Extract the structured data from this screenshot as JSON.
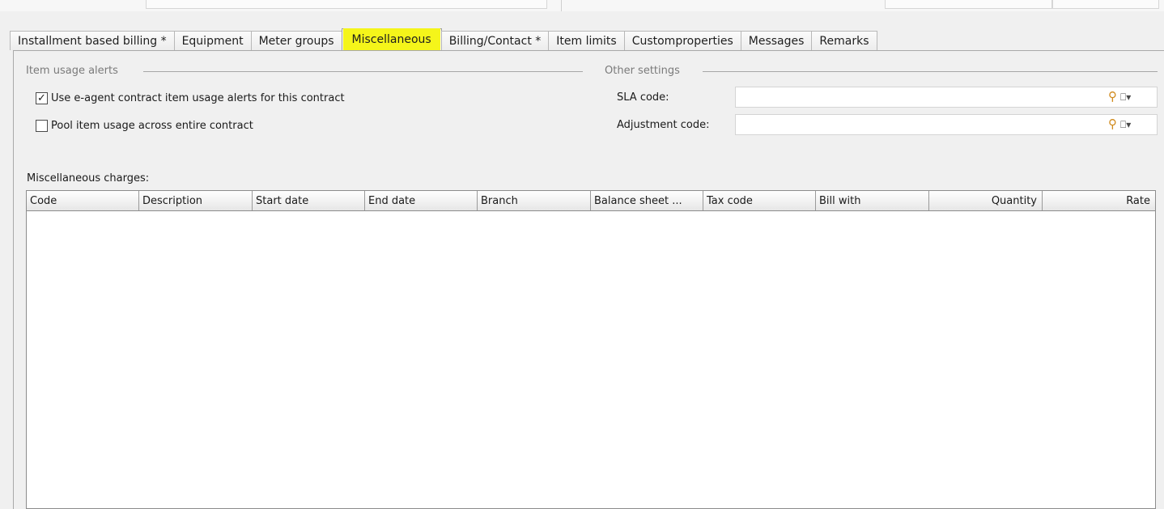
{
  "tabs": [
    {
      "label": "Installment based billing *"
    },
    {
      "label": "Equipment"
    },
    {
      "label": "Meter groups"
    },
    {
      "label": "Miscellaneous"
    },
    {
      "label": "Billing/Contact *"
    },
    {
      "label": "Item limits"
    },
    {
      "label": "Customproperties"
    },
    {
      "label": "Messages"
    },
    {
      "label": "Remarks"
    }
  ],
  "item_usage_alerts": {
    "title": "Item usage alerts",
    "use_alerts": {
      "label": "Use e-agent contract item usage alerts for this contract",
      "checked": true,
      "mark": "✓"
    },
    "pool_usage": {
      "label": "Pool item usage across entire contract",
      "checked": false,
      "mark": ""
    }
  },
  "other_settings": {
    "title": "Other settings",
    "sla": {
      "label": "SLA code:",
      "value": ""
    },
    "adjustment": {
      "label": "Adjustment code:",
      "value": ""
    }
  },
  "misc_charges": {
    "title": "Miscellaneous charges:",
    "columns": [
      "Code",
      "Description",
      "Start date",
      "End date",
      "Branch",
      "Balance sheet ...",
      "Tax code",
      "Bill with",
      "Quantity",
      "Rate"
    ],
    "rows": []
  },
  "colors": {
    "highlight": "#f5f51a",
    "panel_bg": "#f0f0f0",
    "lookup_icon": "#d08a1c"
  },
  "icons": {
    "lookup": "magnifier-icon",
    "picker": "picker-dropdown-icon"
  }
}
